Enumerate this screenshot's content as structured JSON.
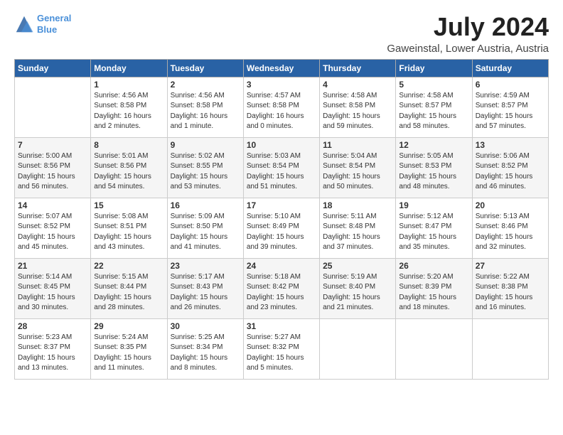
{
  "logo": {
    "line1": "General",
    "line2": "Blue"
  },
  "title": "July 2024",
  "location": "Gaweinstal, Lower Austria, Austria",
  "weekdays": [
    "Sunday",
    "Monday",
    "Tuesday",
    "Wednesday",
    "Thursday",
    "Friday",
    "Saturday"
  ],
  "weeks": [
    [
      {
        "day": "",
        "sunrise": "",
        "sunset": "",
        "daylight": ""
      },
      {
        "day": "1",
        "sunrise": "Sunrise: 4:56 AM",
        "sunset": "Sunset: 8:58 PM",
        "daylight": "Daylight: 16 hours and 2 minutes."
      },
      {
        "day": "2",
        "sunrise": "Sunrise: 4:56 AM",
        "sunset": "Sunset: 8:58 PM",
        "daylight": "Daylight: 16 hours and 1 minute."
      },
      {
        "day": "3",
        "sunrise": "Sunrise: 4:57 AM",
        "sunset": "Sunset: 8:58 PM",
        "daylight": "Daylight: 16 hours and 0 minutes."
      },
      {
        "day": "4",
        "sunrise": "Sunrise: 4:58 AM",
        "sunset": "Sunset: 8:58 PM",
        "daylight": "Daylight: 15 hours and 59 minutes."
      },
      {
        "day": "5",
        "sunrise": "Sunrise: 4:58 AM",
        "sunset": "Sunset: 8:57 PM",
        "daylight": "Daylight: 15 hours and 58 minutes."
      },
      {
        "day": "6",
        "sunrise": "Sunrise: 4:59 AM",
        "sunset": "Sunset: 8:57 PM",
        "daylight": "Daylight: 15 hours and 57 minutes."
      }
    ],
    [
      {
        "day": "7",
        "sunrise": "Sunrise: 5:00 AM",
        "sunset": "Sunset: 8:56 PM",
        "daylight": "Daylight: 15 hours and 56 minutes."
      },
      {
        "day": "8",
        "sunrise": "Sunrise: 5:01 AM",
        "sunset": "Sunset: 8:56 PM",
        "daylight": "Daylight: 15 hours and 54 minutes."
      },
      {
        "day": "9",
        "sunrise": "Sunrise: 5:02 AM",
        "sunset": "Sunset: 8:55 PM",
        "daylight": "Daylight: 15 hours and 53 minutes."
      },
      {
        "day": "10",
        "sunrise": "Sunrise: 5:03 AM",
        "sunset": "Sunset: 8:54 PM",
        "daylight": "Daylight: 15 hours and 51 minutes."
      },
      {
        "day": "11",
        "sunrise": "Sunrise: 5:04 AM",
        "sunset": "Sunset: 8:54 PM",
        "daylight": "Daylight: 15 hours and 50 minutes."
      },
      {
        "day": "12",
        "sunrise": "Sunrise: 5:05 AM",
        "sunset": "Sunset: 8:53 PM",
        "daylight": "Daylight: 15 hours and 48 minutes."
      },
      {
        "day": "13",
        "sunrise": "Sunrise: 5:06 AM",
        "sunset": "Sunset: 8:52 PM",
        "daylight": "Daylight: 15 hours and 46 minutes."
      }
    ],
    [
      {
        "day": "14",
        "sunrise": "Sunrise: 5:07 AM",
        "sunset": "Sunset: 8:52 PM",
        "daylight": "Daylight: 15 hours and 45 minutes."
      },
      {
        "day": "15",
        "sunrise": "Sunrise: 5:08 AM",
        "sunset": "Sunset: 8:51 PM",
        "daylight": "Daylight: 15 hours and 43 minutes."
      },
      {
        "day": "16",
        "sunrise": "Sunrise: 5:09 AM",
        "sunset": "Sunset: 8:50 PM",
        "daylight": "Daylight: 15 hours and 41 minutes."
      },
      {
        "day": "17",
        "sunrise": "Sunrise: 5:10 AM",
        "sunset": "Sunset: 8:49 PM",
        "daylight": "Daylight: 15 hours and 39 minutes."
      },
      {
        "day": "18",
        "sunrise": "Sunrise: 5:11 AM",
        "sunset": "Sunset: 8:48 PM",
        "daylight": "Daylight: 15 hours and 37 minutes."
      },
      {
        "day": "19",
        "sunrise": "Sunrise: 5:12 AM",
        "sunset": "Sunset: 8:47 PM",
        "daylight": "Daylight: 15 hours and 35 minutes."
      },
      {
        "day": "20",
        "sunrise": "Sunrise: 5:13 AM",
        "sunset": "Sunset: 8:46 PM",
        "daylight": "Daylight: 15 hours and 32 minutes."
      }
    ],
    [
      {
        "day": "21",
        "sunrise": "Sunrise: 5:14 AM",
        "sunset": "Sunset: 8:45 PM",
        "daylight": "Daylight: 15 hours and 30 minutes."
      },
      {
        "day": "22",
        "sunrise": "Sunrise: 5:15 AM",
        "sunset": "Sunset: 8:44 PM",
        "daylight": "Daylight: 15 hours and 28 minutes."
      },
      {
        "day": "23",
        "sunrise": "Sunrise: 5:17 AM",
        "sunset": "Sunset: 8:43 PM",
        "daylight": "Daylight: 15 hours and 26 minutes."
      },
      {
        "day": "24",
        "sunrise": "Sunrise: 5:18 AM",
        "sunset": "Sunset: 8:42 PM",
        "daylight": "Daylight: 15 hours and 23 minutes."
      },
      {
        "day": "25",
        "sunrise": "Sunrise: 5:19 AM",
        "sunset": "Sunset: 8:40 PM",
        "daylight": "Daylight: 15 hours and 21 minutes."
      },
      {
        "day": "26",
        "sunrise": "Sunrise: 5:20 AM",
        "sunset": "Sunset: 8:39 PM",
        "daylight": "Daylight: 15 hours and 18 minutes."
      },
      {
        "day": "27",
        "sunrise": "Sunrise: 5:22 AM",
        "sunset": "Sunset: 8:38 PM",
        "daylight": "Daylight: 15 hours and 16 minutes."
      }
    ],
    [
      {
        "day": "28",
        "sunrise": "Sunrise: 5:23 AM",
        "sunset": "Sunset: 8:37 PM",
        "daylight": "Daylight: 15 hours and 13 minutes."
      },
      {
        "day": "29",
        "sunrise": "Sunrise: 5:24 AM",
        "sunset": "Sunset: 8:35 PM",
        "daylight": "Daylight: 15 hours and 11 minutes."
      },
      {
        "day": "30",
        "sunrise": "Sunrise: 5:25 AM",
        "sunset": "Sunset: 8:34 PM",
        "daylight": "Daylight: 15 hours and 8 minutes."
      },
      {
        "day": "31",
        "sunrise": "Sunrise: 5:27 AM",
        "sunset": "Sunset: 8:32 PM",
        "daylight": "Daylight: 15 hours and 5 minutes."
      },
      {
        "day": "",
        "sunrise": "",
        "sunset": "",
        "daylight": ""
      },
      {
        "day": "",
        "sunrise": "",
        "sunset": "",
        "daylight": ""
      },
      {
        "day": "",
        "sunrise": "",
        "sunset": "",
        "daylight": ""
      }
    ]
  ]
}
